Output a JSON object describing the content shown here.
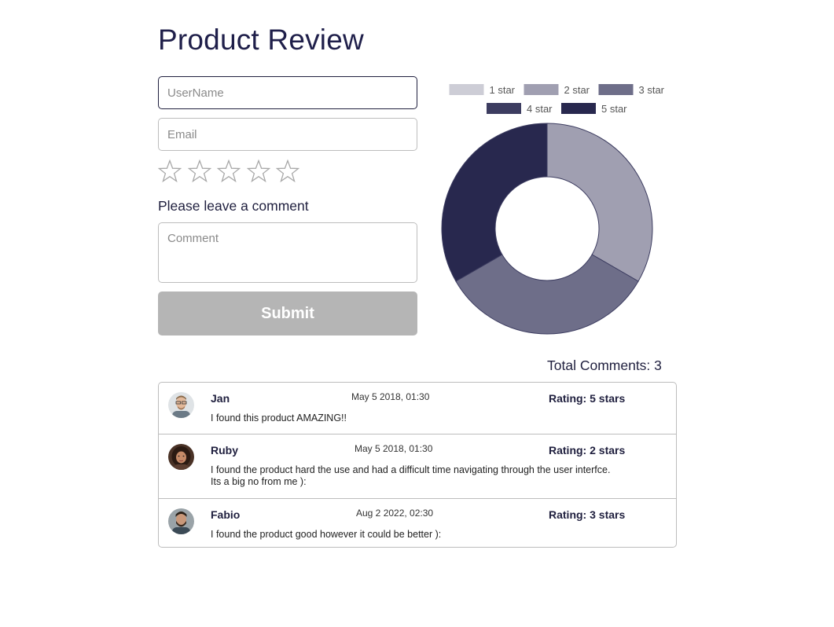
{
  "page": {
    "title": "Product Review"
  },
  "form": {
    "username_placeholder": "UserName",
    "email_placeholder": "Email",
    "stars": [
      {
        "icon": "star-outline-icon",
        "filled": false
      },
      {
        "icon": "star-outline-icon",
        "filled": false
      },
      {
        "icon": "star-outline-icon",
        "filled": false
      },
      {
        "icon": "star-outline-icon",
        "filled": false
      },
      {
        "icon": "star-outline-icon",
        "filled": false
      }
    ],
    "comment_label": "Please leave a comment",
    "comment_placeholder": "Comment",
    "submit_label": "Submit",
    "submit_color": "#b5b5b5"
  },
  "chart_data": {
    "type": "pie",
    "donut": true,
    "legend_position": "top",
    "labels": [
      "1 star",
      "2 star",
      "3 star",
      "4 star",
      "5 star"
    ],
    "values": [
      0,
      1,
      1,
      0,
      1
    ],
    "colors": [
      "#cdcdd6",
      "#a09fb1",
      "#6e6e89",
      "#3c3c60",
      "#28284e"
    ]
  },
  "summary": {
    "total_comments_text": "Total Comments: 3"
  },
  "comments": [
    {
      "name": "Jan",
      "date": "May 5 2018, 01:30",
      "rating": "Rating: 5 stars",
      "text": "I found this product AMAZING!!",
      "avatar": "avatar-jan"
    },
    {
      "name": "Ruby",
      "date": "May 5 2018, 01:30",
      "rating": "Rating: 2 stars",
      "text_lines": [
        "I found the product hard the use and had a difficult time navigating through the user interfce.",
        "Its a big no from me ):"
      ],
      "avatar": "avatar-ruby"
    },
    {
      "name": "Fabio",
      "date": "Aug 2 2022, 02:30",
      "rating": "Rating: 3 stars",
      "text": "I found the product good however it could be better ):",
      "avatar": "avatar-fabio"
    }
  ]
}
